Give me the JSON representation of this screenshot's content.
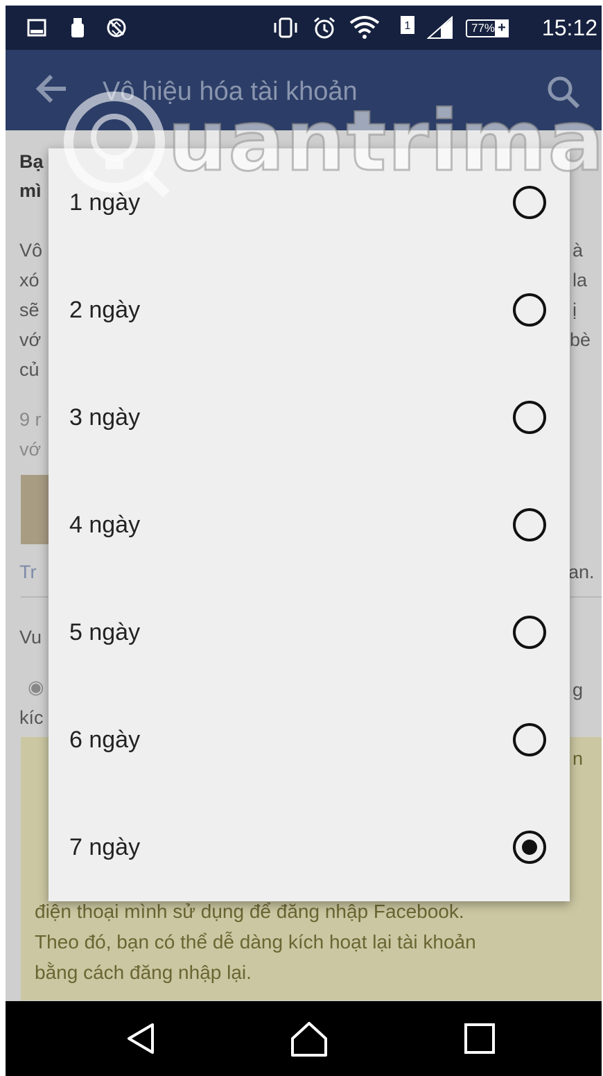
{
  "status_bar": {
    "time": "15:12",
    "battery": "77%",
    "icons": [
      "gallery-notification-icon",
      "usb-icon",
      "no-data-icon",
      "vibrate-icon",
      "alarm-icon",
      "wifi-icon",
      "sim-icon",
      "signal-icon",
      "battery-icon"
    ]
  },
  "app_bar": {
    "title": "Vô hiệu hóa tài khoản",
    "back_icon": "back-arrow-icon",
    "search_icon": "search-icon"
  },
  "background": {
    "lines": [
      {
        "text": "Bạ",
        "bold": true
      },
      {
        "text": "mì",
        "bold": true
      },
      {
        "text": "Vô"
      },
      {
        "text": "xó"
      },
      {
        "text": "sẽ"
      },
      {
        "text": "vớ"
      },
      {
        "text": "củ"
      },
      {
        "text": "9 r"
      },
      {
        "text": "vớ"
      },
      {
        "text": "Tr"
      },
      {
        "text": "Vu"
      },
      {
        "text": "kíc"
      }
    ],
    "right_fragments": [
      "à",
      "la",
      "ị",
      "bè",
      "an.",
      "g",
      "n"
    ],
    "notice": {
      "lines": [
        "điện thoại mình sử dụng để đăng nhập Facebook.",
        "Theo đó, bạn có thể dễ dàng kích hoạt lại tài khoản",
        "bằng cách đăng nhập lại."
      ]
    }
  },
  "dialog": {
    "options": [
      {
        "label": "1 ngày",
        "selected": false
      },
      {
        "label": "2 ngày",
        "selected": false
      },
      {
        "label": "3 ngày",
        "selected": false
      },
      {
        "label": "4 ngày",
        "selected": false
      },
      {
        "label": "5 ngày",
        "selected": false
      },
      {
        "label": "6 ngày",
        "selected": false
      },
      {
        "label": "7 ngày",
        "selected": true
      }
    ]
  },
  "watermark": {
    "text": "uantrimang"
  },
  "nav_bar": {
    "buttons": [
      "back-triangle-icon",
      "home-icon",
      "recents-icon"
    ]
  }
}
